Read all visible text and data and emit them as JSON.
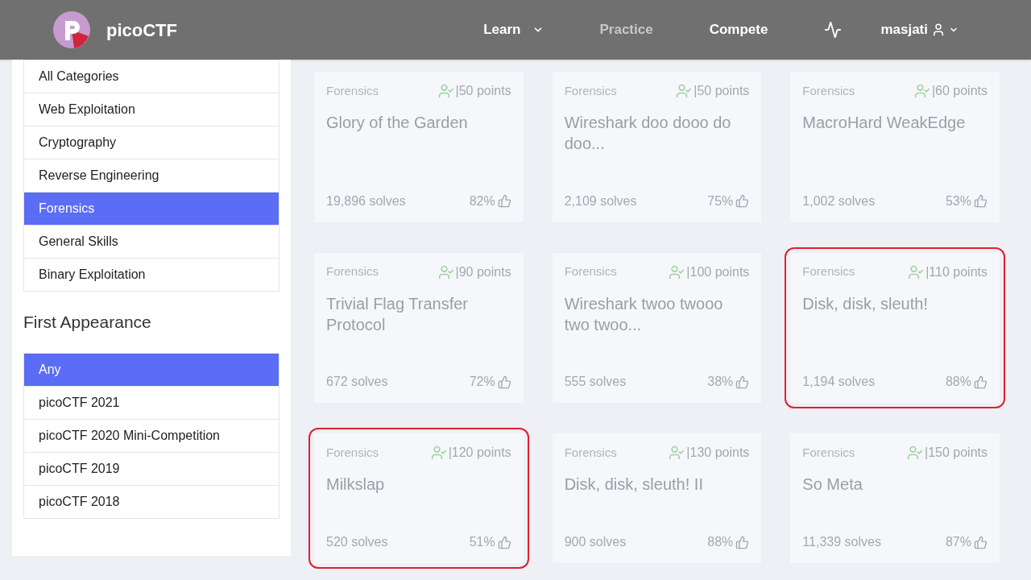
{
  "navbar": {
    "brand": "picoCTF",
    "links": [
      {
        "label": "Learn",
        "dropdown": true,
        "selected": false
      },
      {
        "label": "Practice",
        "dropdown": false,
        "selected": true
      },
      {
        "label": "Compete",
        "dropdown": false,
        "selected": false
      }
    ],
    "user": "masjati"
  },
  "category_filter": {
    "items": [
      {
        "label": "All Categories",
        "selected": false
      },
      {
        "label": "Web Exploitation",
        "selected": false
      },
      {
        "label": "Cryptography",
        "selected": false
      },
      {
        "label": "Reverse Engineering",
        "selected": false
      },
      {
        "label": "Forensics",
        "selected": true
      },
      {
        "label": "General Skills",
        "selected": false
      },
      {
        "label": "Binary Exploitation",
        "selected": false
      }
    ]
  },
  "first_appearance": {
    "title": "First Appearance",
    "items": [
      {
        "label": "Any",
        "selected": true
      },
      {
        "label": "picoCTF 2021",
        "selected": false
      },
      {
        "label": "picoCTF 2020 Mini-Competition",
        "selected": false
      },
      {
        "label": "picoCTF 2019",
        "selected": false
      },
      {
        "label": "picoCTF 2018",
        "selected": false
      }
    ]
  },
  "challenges": [
    {
      "category": "Forensics",
      "points": "|50 points",
      "title": "Glory of the Garden",
      "solves": "19,896 solves",
      "rating": "82%",
      "highlighted": false
    },
    {
      "category": "Forensics",
      "points": "|50 points",
      "title": "Wireshark doo dooo do doo...",
      "solves": "2,109 solves",
      "rating": "75%",
      "highlighted": false
    },
    {
      "category": "Forensics",
      "points": "|60 points",
      "title": "MacroHard WeakEdge",
      "solves": "1,002 solves",
      "rating": "53%",
      "highlighted": false
    },
    {
      "category": "Forensics",
      "points": "|90 points",
      "title": "Trivial Flag Transfer Protocol",
      "solves": "672 solves",
      "rating": "72%",
      "highlighted": false
    },
    {
      "category": "Forensics",
      "points": "|100 points",
      "title": "Wireshark twoo twooo two twoo...",
      "solves": "555 solves",
      "rating": "38%",
      "highlighted": false
    },
    {
      "category": "Forensics",
      "points": "|110 points",
      "title": "Disk, disk, sleuth!",
      "solves": "1,194 solves",
      "rating": "88%",
      "highlighted": true
    },
    {
      "category": "Forensics",
      "points": "|120 points",
      "title": "Milkslap",
      "solves": "520 solves",
      "rating": "51%",
      "highlighted": true
    },
    {
      "category": "Forensics",
      "points": "|130 points",
      "title": "Disk, disk, sleuth! II",
      "solves": "900 solves",
      "rating": "88%",
      "highlighted": false
    },
    {
      "category": "Forensics",
      "points": "|150 points",
      "title": "So Meta",
      "solves": "11,339 solves",
      "rating": "87%",
      "highlighted": false
    }
  ]
}
